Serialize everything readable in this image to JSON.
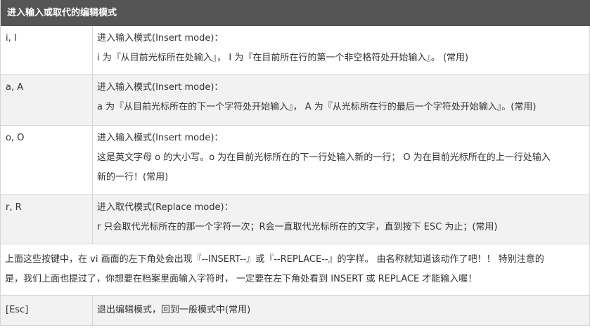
{
  "table": {
    "header": "进入输入或取代的编辑模式",
    "rows": [
      {
        "key": "i, I",
        "lines": [
          "进入输入模式(Insert mode)：",
          "i 为『从目前光标所在处输入』， I 为『在目前所在行的第一个非空格符处开始输入』。 (常用)"
        ]
      },
      {
        "key": "a, A",
        "lines": [
          "进入输入模式(Insert mode)：",
          "a 为『从目前光标所在的下一个字符处开始输入』， A 为『从光标所在行的最后一个字符处开始输入』。(常用)"
        ]
      },
      {
        "key": "o, O",
        "lines": [
          "进入输入模式(Insert mode)：",
          "这是英文字母 o 的大小写。o 为在目前光标所在的下一行处输入新的一行； O 为在目前光标所在的上一行处输入",
          "新的一行！(常用)"
        ]
      },
      {
        "key": "r, R",
        "lines": [
          "进入取代模式(Replace mode)：",
          "r 只会取代光标所在的那一个字符一次；R会一直取代光标所在的文字，直到按下 ESC 为止；(常用)"
        ]
      }
    ],
    "note": [
      "上面这些按键中，在 vi 画面的左下角处会出现『--INSERT--』或『--REPLACE--』的字样。 由名称就知道该动作了吧！！ 特别注意的",
      "是，我们上面也提过了，你想要在档案里面输入字符时， 一定要在左下角处看到 INSERT 或 REPLACE 才能输入喔！"
    ],
    "esc": {
      "key": "[Esc]",
      "desc": "退出编辑模式，回到一般模式中(常用)"
    }
  }
}
